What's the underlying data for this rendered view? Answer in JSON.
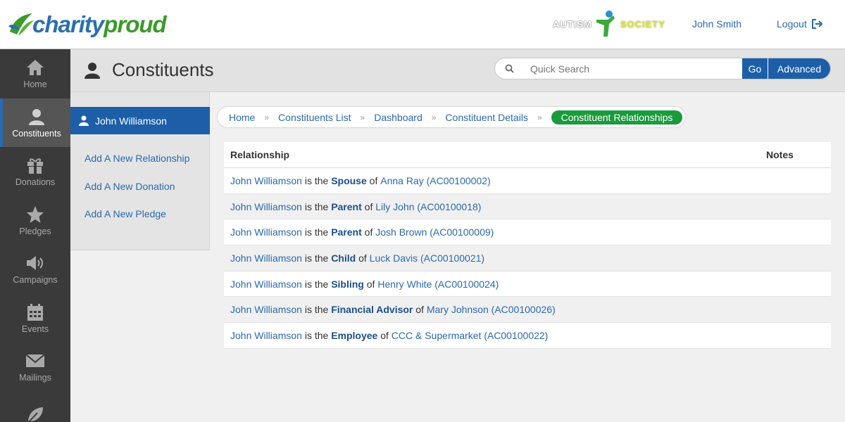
{
  "header": {
    "logo_part1": "charity",
    "logo_part2": "proud",
    "org_word1": "AUTISM",
    "org_word2": "SOCIETY",
    "user_name": "John Smith",
    "logout_label": "Logout"
  },
  "nav": {
    "items": [
      {
        "label": "Home",
        "icon": "home-icon"
      },
      {
        "label": "Constituents",
        "icon": "user-icon",
        "active": true
      },
      {
        "label": "Donations",
        "icon": "gift-icon"
      },
      {
        "label": "Pledges",
        "icon": "star-icon"
      },
      {
        "label": "Campaigns",
        "icon": "megaphone-icon"
      },
      {
        "label": "Events",
        "icon": "calendar-icon"
      },
      {
        "label": "Mailings",
        "icon": "envelope-icon"
      },
      {
        "label": "",
        "icon": "leaf-icon"
      }
    ]
  },
  "page": {
    "title": "Constituents",
    "search_placeholder": "Quick Search",
    "go_label": "Go",
    "advanced_label": "Advanced"
  },
  "sidepanel": {
    "constituent_name": "John Williamson",
    "links": [
      "Add A New Relationship",
      "Add A New Donation",
      "Add A New Pledge"
    ]
  },
  "breadcrumb": {
    "items": [
      "Home",
      "Constituents List",
      "Dashboard",
      "Constituent Details"
    ],
    "separator": "»",
    "active": "Constituent Relationships"
  },
  "table": {
    "headers": {
      "relationship": "Relationship",
      "notes": "Notes"
    },
    "rows": [
      {
        "subject": "John Williamson",
        "is_the": "is the",
        "relation": "Spouse",
        "of": "of",
        "target": "Anna Ray (AC00100002)"
      },
      {
        "subject": "John Williamson",
        "is_the": "is the",
        "relation": "Parent",
        "of": "of",
        "target": "Lily John (AC00100018)"
      },
      {
        "subject": "John Williamson",
        "is_the": "is the",
        "relation": "Parent",
        "of": "of",
        "target": "Josh Brown (AC00100009)"
      },
      {
        "subject": "John Williamson",
        "is_the": "is the",
        "relation": "Child",
        "of": "of",
        "target": "Luck Davis (AC00100021)"
      },
      {
        "subject": "John Williamson",
        "is_the": "is the",
        "relation": "Sibling",
        "of": "of",
        "target": "Henry White (AC00100024)"
      },
      {
        "subject": "John Williamson",
        "is_the": "is the",
        "relation": "Financial Advisor",
        "of": "of",
        "target": "Mary Johnson (AC00100026)"
      },
      {
        "subject": "John Williamson",
        "is_the": "is the",
        "relation": "Employee",
        "of": "of",
        "target": "CCC & Supermarket (AC00100022)"
      }
    ]
  },
  "colors": {
    "primary_blue": "#1c5fa8",
    "active_green": "#1a9a3c",
    "nav_bg": "#3a3a3a",
    "link_blue": "#2a6ab0"
  }
}
